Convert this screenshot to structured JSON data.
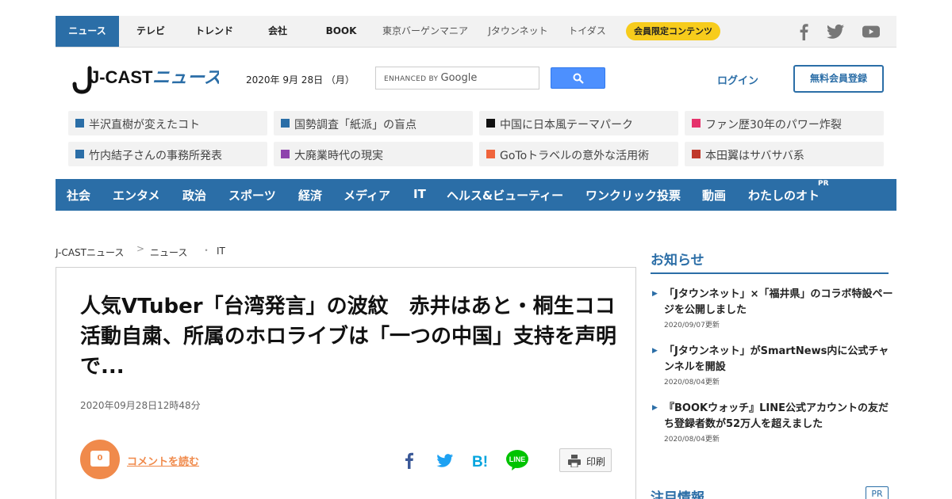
{
  "top_nav": {
    "items": [
      "ニュース",
      "テレビ",
      "トレンド",
      "会社",
      "BOOK",
      "東京バーゲンマニア",
      "Jタウンネット",
      "トイダス"
    ],
    "members_badge": "会員限定コンテンツ",
    "social_icons": [
      "facebook-icon",
      "twitter-icon",
      "youtube-icon"
    ]
  },
  "header": {
    "logo_left": "J-CAST",
    "logo_right": "ニュース",
    "date": "2020年 9月 28日 （月）",
    "search_placeholder_small": "ENHANCED BY",
    "search_placeholder_brand": "Google",
    "login": "ログイン",
    "register": "無料会員登録"
  },
  "topics": [
    {
      "label": "半沢直樹が変えたコト",
      "color": "#2b6ea7"
    },
    {
      "label": "国勢調査「紙派」の盲点",
      "color": "#2b6ea7"
    },
    {
      "label": "中国に日本風テーマパーク",
      "color": "#111111"
    },
    {
      "label": "ファン歴30年のパワー炸裂",
      "color": "#e5336c"
    },
    {
      "label": "竹内結子さんの事務所発表",
      "color": "#2b6ea7"
    },
    {
      "label": "大廃業時代の現実",
      "color": "#8e44ad"
    },
    {
      "label": "GoToトラベルの意外な活用術",
      "color": "#f0643c"
    },
    {
      "label": "本田翼はサバサバ系",
      "color": "#c0392b"
    }
  ],
  "categories": [
    "社会",
    "エンタメ",
    "政治",
    "スポーツ",
    "経済",
    "メディア",
    "IT",
    "ヘルス&ビューティー",
    "ワンクリック投票",
    "動画",
    "わたしのオト"
  ],
  "categories_pr": "PR",
  "breadcrumb": [
    "J-CASTニュース",
    "ニュース",
    "IT"
  ],
  "article": {
    "headline": "人気VTuber「台湾発言」の波紋　赤井はあと・桐生ココ活動自粛、所属のホロライブは「一つの中国」支持を声明で...",
    "timestamp": "2020年09月28日12時48分",
    "comment_count": "0",
    "comment_link": "コメントを読む",
    "share_icons": [
      "facebook-share-icon",
      "twitter-share-icon",
      "hatena-bookmark-icon",
      "line-share-icon"
    ],
    "print": "印刷"
  },
  "sidebar": {
    "notices_title": "お知らせ",
    "notices": [
      {
        "title": "「Jタウンネット」×「福井県」のコラボ特設ページを公開しました",
        "date": "2020/09/07更新"
      },
      {
        "title": "「Jタウンネット」がSmartNews内に公式チャンネルを開設",
        "date": "2020/08/04更新"
      },
      {
        "title": "『BOOKウォッチ』LINE公式アカウントの友だち登録者数が52万人を超えました",
        "date": "2020/08/04更新"
      }
    ],
    "attention_title": "注目情報",
    "attention_pr": "PR"
  },
  "colors": {
    "brand_blue": "#2b6ea7",
    "accent_orange": "#f08a4b",
    "badge_yellow": "#f7cc1c"
  }
}
